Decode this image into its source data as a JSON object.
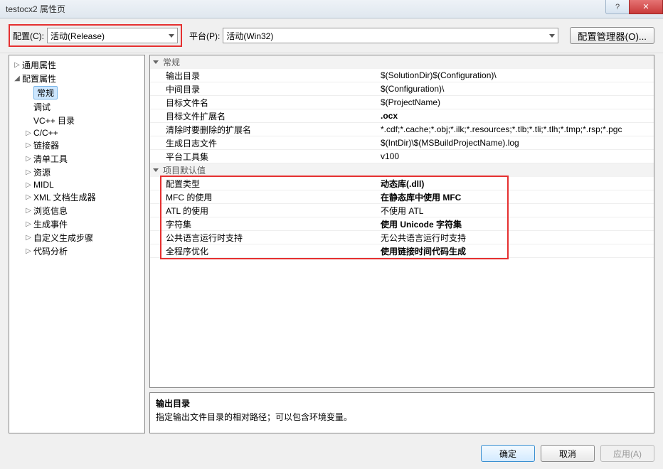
{
  "titlebar": {
    "title": "testocx2 属性页"
  },
  "configBar": {
    "configLabel": "配置(C):",
    "configValue": "活动(Release)",
    "platformLabel": "平台(P):",
    "platformValue": "活动(Win32)",
    "configManagerLabel": "配置管理器(O)..."
  },
  "tree": {
    "items": [
      {
        "label": "通用属性",
        "level": 0,
        "expander": "▷"
      },
      {
        "label": "配置属性",
        "level": 0,
        "expander": "◢"
      },
      {
        "label": "常规",
        "level": 1,
        "expander": "",
        "selected": true
      },
      {
        "label": "调试",
        "level": 1,
        "expander": ""
      },
      {
        "label": "VC++ 目录",
        "level": 1,
        "expander": ""
      },
      {
        "label": "C/C++",
        "level": 1,
        "expander": "▷"
      },
      {
        "label": "链接器",
        "level": 1,
        "expander": "▷"
      },
      {
        "label": "清单工具",
        "level": 1,
        "expander": "▷"
      },
      {
        "label": "资源",
        "level": 1,
        "expander": "▷"
      },
      {
        "label": "MIDL",
        "level": 1,
        "expander": "▷"
      },
      {
        "label": "XML 文档生成器",
        "level": 1,
        "expander": "▷"
      },
      {
        "label": "浏览信息",
        "level": 1,
        "expander": "▷"
      },
      {
        "label": "生成事件",
        "level": 1,
        "expander": "▷"
      },
      {
        "label": "自定义生成步骤",
        "level": 1,
        "expander": "▷"
      },
      {
        "label": "代码分析",
        "level": 1,
        "expander": "▷"
      }
    ]
  },
  "propGrid": {
    "section1": "常规",
    "section2": "项目默认值",
    "rows1": [
      {
        "name": "输出目录",
        "value": "$(SolutionDir)$(Configuration)\\"
      },
      {
        "name": "中间目录",
        "value": "$(Configuration)\\"
      },
      {
        "name": "目标文件名",
        "value": "$(ProjectName)"
      },
      {
        "name": "目标文件扩展名",
        "value": ".ocx",
        "bold": true
      },
      {
        "name": "清除时要删除的扩展名",
        "value": "*.cdf;*.cache;*.obj;*.ilk;*.resources;*.tlb;*.tli;*.tlh;*.tmp;*.rsp;*.pgc"
      },
      {
        "name": "生成日志文件",
        "value": "$(IntDir)\\$(MSBuildProjectName).log"
      },
      {
        "name": "平台工具集",
        "value": "v100"
      }
    ],
    "rows2": [
      {
        "name": "配置类型",
        "value": "动态库(.dll)",
        "bold": true
      },
      {
        "name": "MFC 的使用",
        "value": "在静态库中使用 MFC",
        "bold": true
      },
      {
        "name": "ATL 的使用",
        "value": "不使用 ATL"
      },
      {
        "name": "字符集",
        "value": "使用 Unicode 字符集",
        "bold": true
      },
      {
        "name": "公共语言运行时支持",
        "value": "无公共语言运行时支持"
      },
      {
        "name": "全程序优化",
        "value": "使用链接时间代码生成",
        "bold": true
      }
    ]
  },
  "descPanel": {
    "title": "输出目录",
    "text": "指定输出文件目录的相对路径；可以包含环境变量。"
  },
  "footer": {
    "ok": "确定",
    "cancel": "取消",
    "apply": "应用(A)"
  }
}
